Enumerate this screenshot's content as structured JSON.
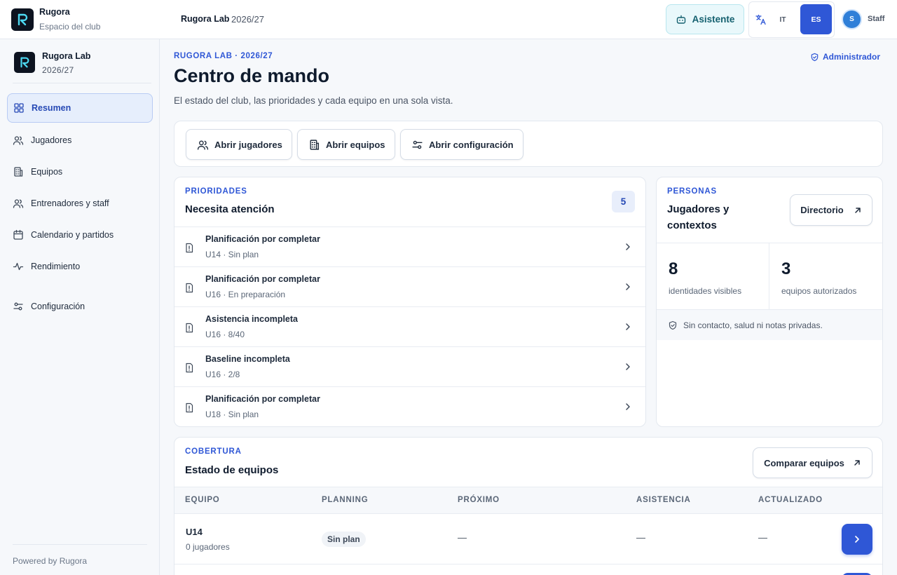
{
  "brand": {
    "name": "Rugora",
    "subtitle": "Espacio del club"
  },
  "topbar": {
    "club": "Rugora Lab",
    "season": "2026/27",
    "assistant_label": "Asistente",
    "languages": [
      "IT",
      "ES"
    ],
    "active_language": "ES",
    "user_initial": "S",
    "user_role": "Staff"
  },
  "sidebar": {
    "club": "Rugora Lab",
    "season": "2026/27",
    "items": [
      {
        "label": "Resumen",
        "icon": "grid-icon",
        "active": true
      },
      {
        "label": "Jugadores",
        "icon": "users-icon"
      },
      {
        "label": "Equipos",
        "icon": "building-icon"
      },
      {
        "label": "Entrenadores y staff",
        "icon": "users-icon"
      },
      {
        "label": "Calendario y partidos",
        "icon": "calendar-icon"
      },
      {
        "label": "Rendimiento",
        "icon": "activity-icon"
      },
      {
        "label": "Configuración",
        "icon": "sliders-icon"
      }
    ],
    "footer": "Powered by Rugora"
  },
  "header": {
    "eyebrow": "RUGORA LAB · 2026/27",
    "title": "Centro de mando",
    "subtitle": "El estado del club, las prioridades y cada equipo en una sola vista.",
    "role_link": "Administrador"
  },
  "quick_actions": [
    "Abrir jugadores",
    "Abrir equipos",
    "Abrir configuración"
  ],
  "priorities": {
    "eyebrow": "PRIORIDADES",
    "title": "Necesita atención",
    "count": "5",
    "items": [
      {
        "title": "Planificación por completar",
        "sub": "U14 · Sin plan"
      },
      {
        "title": "Planificación por completar",
        "sub": "U16 · En preparación"
      },
      {
        "title": "Asistencia incompleta",
        "sub": "U16 · 8/40"
      },
      {
        "title": "Baseline incompleta",
        "sub": "U16 · 2/8"
      },
      {
        "title": "Planificación por completar",
        "sub": "U18 · Sin plan"
      }
    ]
  },
  "people": {
    "eyebrow": "PERSONAS",
    "title_line1": "Jugadores y",
    "title_line2": "contextos",
    "directory_label": "Directorio",
    "stats": [
      {
        "value": "8",
        "label": "identidades visibles"
      },
      {
        "value": "3",
        "label": "equipos autorizados"
      }
    ],
    "privacy_note": "Sin contacto, salud ni notas privadas."
  },
  "coverage": {
    "eyebrow": "COBERTURA",
    "title": "Estado de equipos",
    "compare_label": "Comparar equipos",
    "columns": [
      "EQUIPO",
      "PLANNING",
      "PRÓXIMO",
      "ASISTENCIA",
      "ACTUALIZADO"
    ],
    "rows": [
      {
        "team": "U14",
        "players": "0 jugadores",
        "planning": "Sin plan",
        "next": "—",
        "attendance": "—",
        "updated": "—"
      }
    ]
  },
  "colors": {
    "accent": "#2f57d6",
    "assistant": "#14606f",
    "ink": "#0f1b2d"
  }
}
